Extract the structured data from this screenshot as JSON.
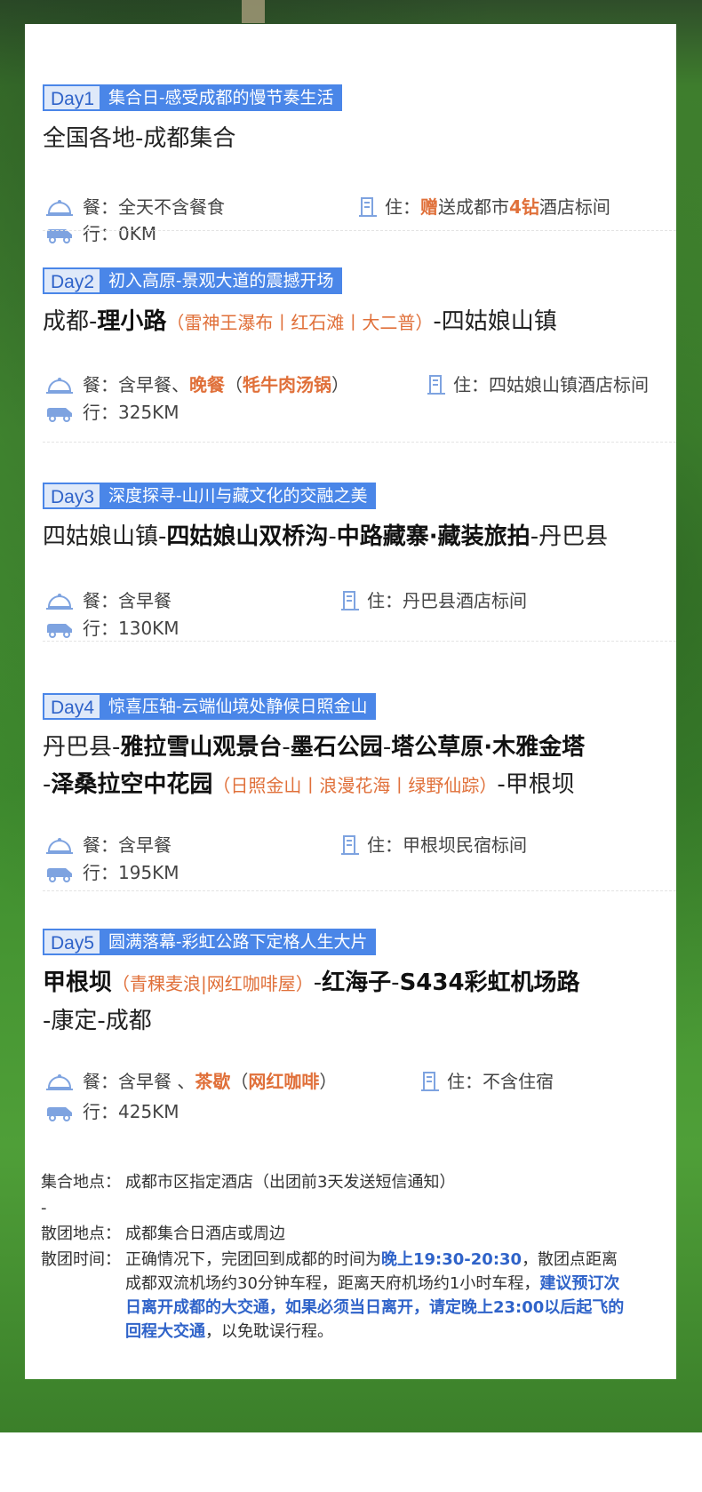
{
  "days": [
    {
      "num": "Day1",
      "title": "集合日-感受成都的慢节奏生活",
      "route_plain": "全国各地-成都集合",
      "meal_label": "餐：",
      "meal": "全天不含餐食",
      "stay_label": "住：",
      "stay_hl1": "赠",
      "stay_mid": "送成都市",
      "stay_hl2": "4钻",
      "stay_end": "酒店标间",
      "travel_label": "行：",
      "travel": "0KM"
    },
    {
      "num": "Day2",
      "title": "初入高原-景观大道的震撼开场",
      "route_a": "成都-",
      "route_b": "理小路",
      "route_o": "（雷神王瀑布丨红石滩丨大二普）",
      "route_c": "-四姑娘山镇",
      "meal_label": "餐：",
      "meal_a": "含早餐、",
      "meal_b": "晚餐",
      "meal_c": "（",
      "meal_d": "牦牛肉汤锅",
      "meal_e": "）",
      "stay_label": "住：",
      "stay": "四姑娘山镇酒店标间",
      "travel_label": "行：",
      "travel": "325KM"
    },
    {
      "num": "Day3",
      "title": "深度探寻-山川与藏文化的交融之美",
      "route_a": "四姑娘山镇-",
      "route_b": "四姑娘山双桥沟",
      "route_c": "-",
      "route_d": "中路藏寨·藏装旅拍",
      "route_e": "-丹巴县",
      "meal_label": "餐：",
      "meal": "含早餐",
      "stay_label": "住：",
      "stay": "丹巴县酒店标间",
      "travel_label": "行：",
      "travel": "130KM"
    },
    {
      "num": "Day4",
      "title": "惊喜压轴-云端仙境处静候日照金山",
      "route_a": "丹巴县-",
      "route_b": "雅拉雪山观景台",
      "route_c": "-",
      "route_d": "墨石公园",
      "route_e": "-",
      "route_f": "塔公草原·木雅金塔",
      "route_g": "-",
      "route_h": "泽桑拉空中花园",
      "route_o": "（日照金山丨浪漫花海丨绿野仙踪）",
      "route_i": "-甲根坝",
      "meal_label": "餐：",
      "meal": "含早餐",
      "stay_label": "住：",
      "stay": "甲根坝民宿标间",
      "travel_label": "行：",
      "travel": "195KM"
    },
    {
      "num": "Day5",
      "title": "圆满落幕-彩虹公路下定格人生大片",
      "route_a": "甲根坝",
      "route_o": "（青稞麦浪|网红咖啡屋）",
      "route_b": "-",
      "route_c": "红海子",
      "route_d": "-",
      "route_e": "S434彩虹机场路",
      "route_f": "-康定-成都",
      "meal_label": "餐：",
      "meal_a": "含早餐 、",
      "meal_b": "茶歇",
      "meal_c": "（",
      "meal_d": "网红咖啡",
      "meal_e": "）",
      "stay_label": "住：",
      "stay": "不含住宿",
      "travel_label": "行：",
      "travel": "425KM"
    }
  ],
  "notes": {
    "gather_label": "集合地点：",
    "gather": "成都市区指定酒店（出团前3天发送短信通知）",
    "dash": "-",
    "disband_place_label": "散团地点：",
    "disband_place": "成都集合日酒店或周边",
    "disband_time_label": "散团时间：",
    "disband_time_a": "正确情况下，完团回到成都的时间为",
    "disband_time_b": "晚上19:30-20:30",
    "disband_time_c": "，散团点距离成都双流机场约30分钟车程，距离天府机场约1小时车程，",
    "disband_time_d": "建议预订次日离开成都的大交通，如果必须当日离开，请定晚上23:00以后起飞的回程大交通",
    "disband_time_e": "，以免耽误行程。"
  },
  "colors": {
    "accent_blue": "#4a86e8",
    "accent_orange": "#e0703a",
    "grass": "#4a9a34"
  },
  "icons": [
    "dining-cloche-icon",
    "building-icon",
    "car-icon"
  ]
}
